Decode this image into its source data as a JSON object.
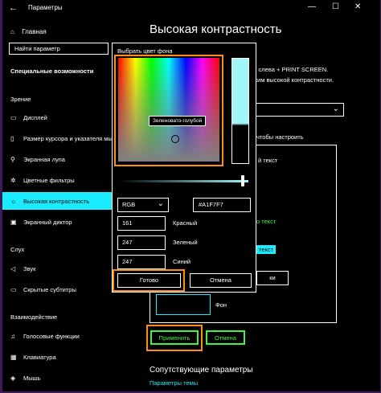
{
  "window": {
    "title": "Параметры",
    "controls": [
      "—",
      "☐",
      "✕"
    ]
  },
  "sidebar": {
    "home": "Главная",
    "search_placeholder": "Найти параметр",
    "section_title": "Специальные возможности",
    "groups": [
      {
        "label": "Зрение"
      },
      {
        "label": "Слух"
      },
      {
        "label": "Взаимодействие"
      }
    ],
    "items": [
      {
        "label": "Дисплей",
        "icon": "display-icon"
      },
      {
        "label": "Размер курсора и указателя мыши",
        "icon": "cursor-icon"
      },
      {
        "label": "Экранная лупа",
        "icon": "magnifier-icon"
      },
      {
        "label": "Цветные фильтры",
        "icon": "color-filter-icon"
      },
      {
        "label": "Высокая контрастность",
        "icon": "contrast-icon",
        "active": true
      },
      {
        "label": "Экранный диктор",
        "icon": "narrator-icon"
      },
      {
        "label": "Звук",
        "icon": "speaker-icon"
      },
      {
        "label": "Скрытые субтитры",
        "icon": "captions-icon"
      },
      {
        "label": "Голосовые функции",
        "icon": "microphone-icon"
      },
      {
        "label": "Клавиатура",
        "icon": "keyboard-icon"
      },
      {
        "label": "Мышь",
        "icon": "mouse-icon"
      }
    ]
  },
  "main": {
    "title": "Высокая контрастность",
    "shortcut_text": "T слева + PRINT SCREEN.",
    "mode_text": "жим высокой контрастности.",
    "customize_text": "чтобы настроить",
    "text_partial": "й текст",
    "text_green_partial": "о текст",
    "btn_partial": "ки",
    "background_label": "Фон",
    "apply_button": "Применить",
    "cancel_button": "Отмена",
    "related_title": "Сопутствующие параметры",
    "theme_link": "Параметры темы"
  },
  "color_dialog": {
    "title": "Выбрать цвет фона",
    "tooltip": "Зеленовато-голубой",
    "mode": "RGB",
    "hex": "#A1F7F7",
    "red_value": "161",
    "red_label": "Красный",
    "green_value": "247",
    "green_label": "Зеленый",
    "blue_value": "247",
    "blue_label": "Синий",
    "done_button": "Готово",
    "cancel_button": "Отмена",
    "selected_color": "#A1F7F7",
    "slider_level": 0.97
  },
  "colors": {
    "accent": "#1aebff",
    "highlight": "#ff8a1e",
    "green_text": "#3ff23f",
    "bg": "#000000"
  }
}
